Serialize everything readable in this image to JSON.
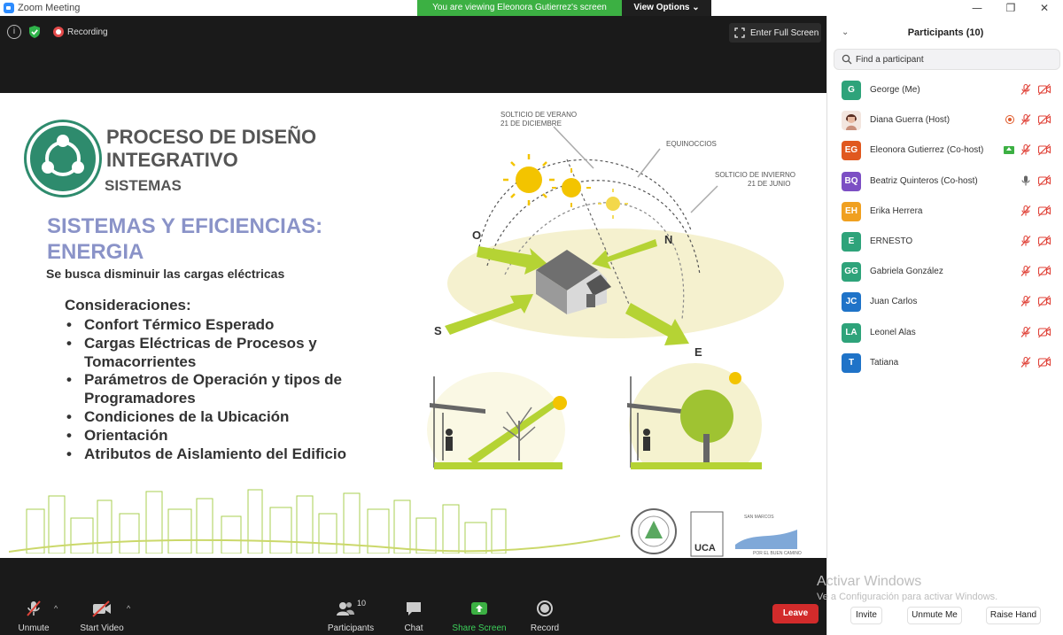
{
  "window": {
    "title": "Zoom Meeting",
    "viewing_message": "You are viewing Eleonora Gutierrez's screen",
    "view_options": "View Options ⌄",
    "minimize": "—",
    "restore": "❐",
    "close": "✕"
  },
  "meeting_bar": {
    "recording": "Recording",
    "full_screen": "Enter Full Screen",
    "info_symbol": "i"
  },
  "slide": {
    "title": "PROCESO DE DISEÑO INTEGRATIVO",
    "subtitle": "SISTEMAS",
    "heading": "SISTEMAS Y EFICIENCIAS: ENERGIA",
    "description": "Se busca disminuir las cargas eléctricas",
    "considerations_heading": "Consideraciones:",
    "considerations": [
      "Confort Térmico Esperado",
      "Cargas Eléctricas de Procesos y Tomacorrientes",
      "Parámetros de Operación y tipos de Programadores",
      "Condiciones de la Ubicación",
      "Orientación",
      "Atributos de Aislamiento del Edificio"
    ],
    "diagram": {
      "summer_solstice_l1": "SOLTICIO DE VERANO",
      "summer_solstice_l2": "21 DE DICIEMBRE",
      "equinox": "EQUINOCCIOS",
      "winter_solstice_l1": "SOLTICIO DE INVIERNO",
      "winter_solstice_l2": "21 DE JUNIO",
      "west": "O",
      "north": "N",
      "south": "S",
      "east": "E"
    },
    "partner_logos": {
      "uca": "UCA",
      "san_marcos": "SAN MARCOS",
      "motto": "POR EL BUEN CAMINO"
    }
  },
  "toolbar": {
    "unmute": "Unmute",
    "start_video": "Start Video",
    "participants": "Participants",
    "participants_count": "10",
    "chat": "Chat",
    "share_screen": "Share Screen",
    "record": "Record",
    "leave": "Leave",
    "caret": "^"
  },
  "panel": {
    "title": "Participants (10)",
    "search_placeholder": "Find a participant",
    "participants": [
      {
        "initials": "G",
        "name": "George (Me)",
        "color": "#2ea37a",
        "status": "none"
      },
      {
        "initials": "",
        "name": "Diana Guerra (Host)",
        "color": "#c98f7a",
        "status": "host-photo"
      },
      {
        "initials": "EG",
        "name": "Eleonora Gutierrez (Co-host)",
        "color": "#e0581f",
        "status": "sharing"
      },
      {
        "initials": "BQ",
        "name": "Beatriz Quinteros (Co-host)",
        "color": "#7c4fc4",
        "status": "mic-on"
      },
      {
        "initials": "EH",
        "name": "Erika Herrera",
        "color": "#f0a020",
        "status": "none"
      },
      {
        "initials": "E",
        "name": "ERNESTO",
        "color": "#2ea37a",
        "status": "none"
      },
      {
        "initials": "GG",
        "name": "Gabriela González",
        "color": "#2ea37a",
        "status": "none"
      },
      {
        "initials": "JC",
        "name": "Juan Carlos",
        "color": "#1f73c8",
        "status": "none"
      },
      {
        "initials": "LA",
        "name": "Leonel Alas",
        "color": "#2ea37a",
        "status": "none"
      },
      {
        "initials": "T",
        "name": "Tatiana",
        "color": "#1f73c8",
        "status": "none"
      }
    ],
    "invite": "Invite",
    "unmute_me": "Unmute Me",
    "raise_hand": "Raise Hand"
  },
  "watermark": {
    "line1": "Activar Windows",
    "line2": "Ve a Configuración para activar Windows."
  },
  "colors": {
    "accent_green": "#3cb043",
    "leave_red": "#d22b2b",
    "slide_heading": "#8a93c8",
    "muted_red": "#e0443a"
  }
}
